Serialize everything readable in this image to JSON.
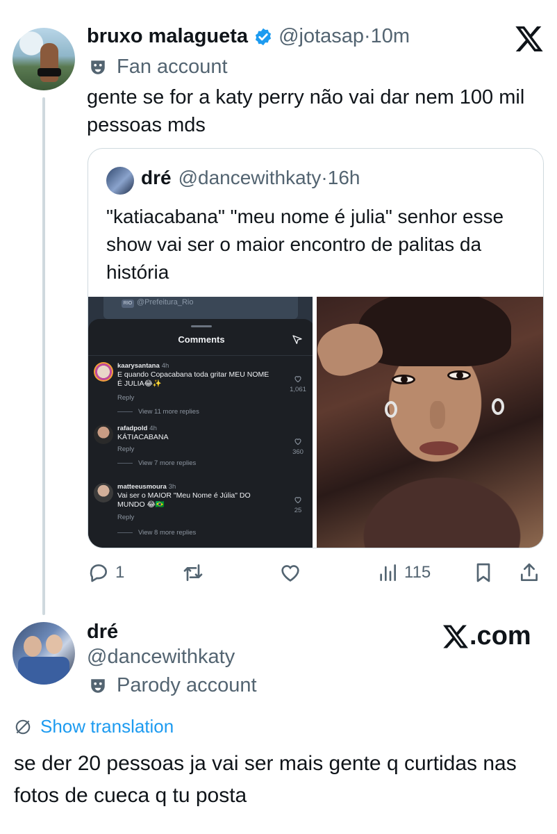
{
  "main_tweet": {
    "author_name": "bruxo malagueta",
    "handle_time": "@jotasap·10m",
    "badge_icon": "mask-icon",
    "badge_text": "Fan account",
    "text": "gente se for a katy perry não vai dar nem 100 mil pessoas mds",
    "verified_color": "#1d9bf0"
  },
  "quoted_tweet": {
    "author_name": "dré",
    "handle_time": "@dancewithkaty·16h",
    "text": "\"katiacabana\" \"meu nome é julia\" senhor esse show vai ser o maior encontro de palitas da história"
  },
  "instagram_screenshot": {
    "top_account": "@Prefeitura_Rio",
    "top_badge": "RIO",
    "title": "Comments",
    "comments": [
      {
        "user": "kaarysantana",
        "time": "4h",
        "text": "E quando Copacabana toda gritar MEU NOME É JULIA😂✨",
        "reply": "Reply",
        "more": "View 11 more replies",
        "likes": "1,061"
      },
      {
        "user": "rafadpold",
        "time": "4h",
        "text": "KÁTIACABANA",
        "reply": "Reply",
        "more": "View 7 more replies",
        "likes": "360"
      },
      {
        "user": "matteeusmoura",
        "time": "3h",
        "text": "Vai ser o MAIOR \"Meu Nome é Júlia\" DO MUNDO 😂🇧🇷",
        "reply": "Reply",
        "more": "View 8 more replies",
        "likes": "25"
      }
    ]
  },
  "actions": {
    "replies": "1",
    "views": "115"
  },
  "brand": {
    "x_suffix": ".com"
  },
  "reply": {
    "author_name": "dré",
    "handle": "@dancewithkaty",
    "badge_text": "Parody account",
    "show_translation": "Show translation",
    "text": "se der 20 pessoas ja vai ser mais gente q curtidas nas fotos de cueca q tu posta"
  },
  "colors": {
    "link": "#1d9bf0",
    "secondary_text": "#536471",
    "border": "#cfd9de"
  }
}
